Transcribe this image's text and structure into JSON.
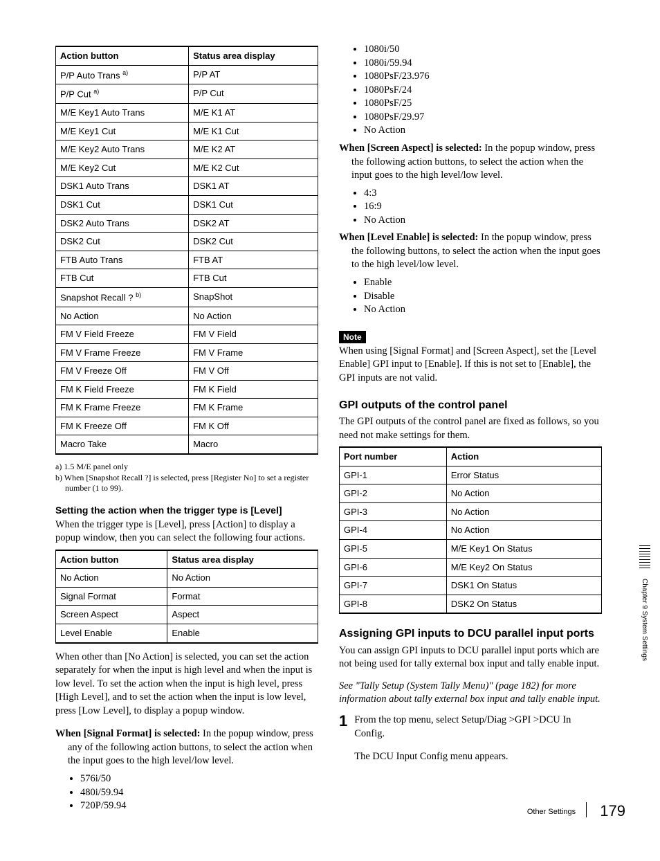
{
  "table1": {
    "headers": [
      "Action button",
      "Status area display"
    ],
    "rows": [
      [
        "P/P Auto Trans",
        "a)",
        "P/P AT"
      ],
      [
        "P/P Cut",
        "a)",
        "P/P Cut"
      ],
      [
        "M/E Key1 Auto Trans",
        "",
        "M/E K1 AT"
      ],
      [
        "M/E Key1 Cut",
        "",
        "M/E K1 Cut"
      ],
      [
        "M/E Key2 Auto Trans",
        "",
        "M/E K2 AT"
      ],
      [
        "M/E Key2 Cut",
        "",
        "M/E K2 Cut"
      ],
      [
        "DSK1 Auto Trans",
        "",
        "DSK1 AT"
      ],
      [
        "DSK1 Cut",
        "",
        "DSK1 Cut"
      ],
      [
        "DSK2 Auto Trans",
        "",
        "DSK2 AT"
      ],
      [
        "DSK2 Cut",
        "",
        "DSK2 Cut"
      ],
      [
        "FTB Auto Trans",
        "",
        "FTB AT"
      ],
      [
        "FTB Cut",
        "",
        "FTB Cut"
      ],
      [
        "Snapshot Recall ?",
        "b)",
        "SnapShot"
      ],
      [
        "No Action",
        "",
        "No Action"
      ],
      [
        "FM V Field Freeze",
        "",
        "FM V Field"
      ],
      [
        "FM V Frame Freeze",
        "",
        "FM V Frame"
      ],
      [
        "FM V Freeze Off",
        "",
        "FM V Off"
      ],
      [
        "FM K Field Freeze",
        "",
        "FM K Field"
      ],
      [
        "FM K Frame Freeze",
        "",
        "FM K Frame"
      ],
      [
        "FM K Freeze Off",
        "",
        "FM K Off"
      ],
      [
        "Macro Take",
        "",
        "Macro"
      ]
    ]
  },
  "footnotes": {
    "a": "a) 1.5 M/E panel only",
    "b": "b) When [Snapshot Recall ?] is selected, press [Register No] to set a register number (1 to 99)."
  },
  "h3_level": "Setting the action when the trigger type is [Level]",
  "p_level": "When the trigger type is [Level], press [Action] to display a popup window, then you can select the following four actions.",
  "table2": {
    "headers": [
      "Action button",
      "Status area display"
    ],
    "rows": [
      [
        "No Action",
        "No Action"
      ],
      [
        "Signal Format",
        "Format"
      ],
      [
        "Screen Aspect",
        "Aspect"
      ],
      [
        "Level Enable",
        "Enable"
      ]
    ]
  },
  "p_other": "When other than [No Action] is selected, you can set the action separately for when the input is high level and when the input is low level. To set the action when the input is high level, press [High Level], and to set the action when the input is low level, press [Low Level], to display a popup window.",
  "sf_lead": "When [Signal Format] is selected:",
  "sf_body": " In the popup window, press any of the following action buttons, to select the action when the input goes to the high level/low level.",
  "sf_items_left": [
    "576i/50",
    "480i/59.94",
    "720P/59.94"
  ],
  "sf_items_right": [
    "1080i/50",
    "1080i/59.94",
    "1080PsF/23.976",
    "1080PsF/24",
    "1080PsF/25",
    "1080PsF/29.97",
    "No Action"
  ],
  "sa_lead": "When [Screen Aspect] is selected:",
  "sa_body": " In the popup window, press the following action buttons, to select the action when the input goes to the high level/low level.",
  "sa_items": [
    "4:3",
    "16:9",
    "No Action"
  ],
  "le_lead": "When [Level Enable] is selected:",
  "le_body": " In the popup window, press the following buttons, to select the action when the input goes to the high level/low level.",
  "le_items": [
    "Enable",
    "Disable",
    "No Action"
  ],
  "note_label": "Note",
  "note_body": "When using [Signal Format] and [Screen Aspect], set the [Level Enable] GPI input to [Enable]. If this is not set to [Enable], the GPI inputs are not valid.",
  "h2_gpi_out": "GPI outputs of the control panel",
  "p_gpi_out": "The GPI outputs of the control panel are fixed as follows, so you need not make settings for them.",
  "table3": {
    "headers": [
      "Port number",
      "Action"
    ],
    "rows": [
      [
        "GPI-1",
        "Error Status"
      ],
      [
        "GPI-2",
        "No Action"
      ],
      [
        "GPI-3",
        "No Action"
      ],
      [
        "GPI-4",
        "No Action"
      ],
      [
        "GPI-5",
        "M/E Key1 On Status"
      ],
      [
        "GPI-6",
        "M/E Key2 On Status"
      ],
      [
        "GPI-7",
        "DSK1 On Status"
      ],
      [
        "GPI-8",
        "DSK2 On Status"
      ]
    ]
  },
  "h2_dcu": "Assigning GPI inputs to DCU parallel input ports",
  "p_dcu": "You can assign GPI inputs to DCU parallel input ports which are not being used for tally external box input and tally enable input.",
  "p_dcu_see": "See \"Tally Setup (System Tally Menu)\" (page 182) for more information about tally external box input and tally enable input.",
  "step1_num": "1",
  "step1_a": "From the top menu, select Setup/Diag >GPI >DCU In Config.",
  "step1_b": "The DCU Input Config menu appears.",
  "sidecap": "Chapter 9  System Settings",
  "footer_label": "Other Settings",
  "footer_page": "179"
}
